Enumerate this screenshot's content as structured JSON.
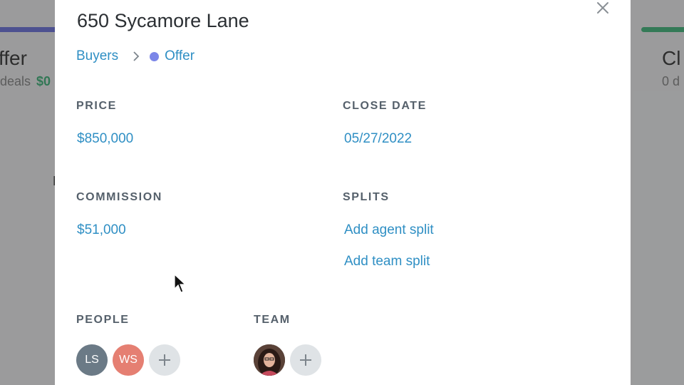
{
  "background": {
    "left_column": {
      "title": "ffer",
      "deals": "deals",
      "amount": "$0",
      "ghost_text": "N"
    },
    "right_column": {
      "title": "Cl",
      "deals": "0 d"
    }
  },
  "modal": {
    "title": "650 Sycamore Lane",
    "breadcrumb": {
      "pipeline": "Buyers",
      "stage": "Offer",
      "stage_color": "#7b86e8"
    },
    "price": {
      "label": "PRICE",
      "value": "$850,000"
    },
    "close_date": {
      "label": "CLOSE DATE",
      "value": "05/27/2022"
    },
    "commission": {
      "label": "COMMISSION",
      "value": "$51,000"
    },
    "splits": {
      "label": "SPLITS",
      "add_agent": "Add agent split",
      "add_team": "Add team split"
    },
    "people": {
      "label": "PEOPLE",
      "members": [
        "LS",
        "WS"
      ]
    },
    "team": {
      "label": "TEAM"
    }
  },
  "colors": {
    "link": "#2f8fc4",
    "label": "#55606b",
    "avatar_ls": "#6b7a86",
    "avatar_ws": "#e57f72"
  }
}
